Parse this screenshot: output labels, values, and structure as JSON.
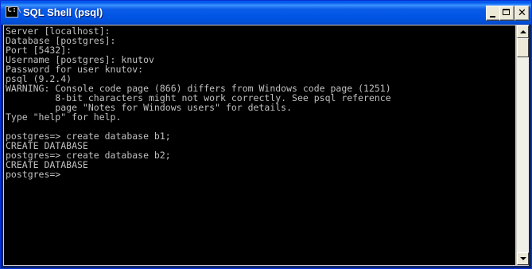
{
  "window": {
    "title": "SQL Shell (psql)",
    "icon": "console-app-icon",
    "icon_glyph": "C:\\"
  },
  "titlebar_buttons": {
    "minimize": "minimize-icon",
    "maximize": "maximize-icon",
    "close": "close-icon",
    "close_glyph": "✕"
  },
  "console": {
    "background": "#000000",
    "foreground": "#c0c0c0",
    "lines": [
      "Server [localhost]:",
      "Database [postgres]:",
      "Port [5432]:",
      "Username [postgres]: knutov",
      "Password for user knutov:",
      "psql (9.2.4)",
      "WARNING: Console code page (866) differs from Windows code page (1251)",
      "         8-bit characters might not work correctly. See psql reference",
      "         page \"Notes for Windows users\" for details.",
      "Type \"help\" for help.",
      "",
      "postgres=> create database b1;",
      "CREATE DATABASE",
      "postgres=> create database b2;",
      "CREATE DATABASE",
      "postgres=>"
    ]
  },
  "scrollbar": {
    "up": "scroll-up-arrow-icon",
    "down": "scroll-down-arrow-icon"
  }
}
